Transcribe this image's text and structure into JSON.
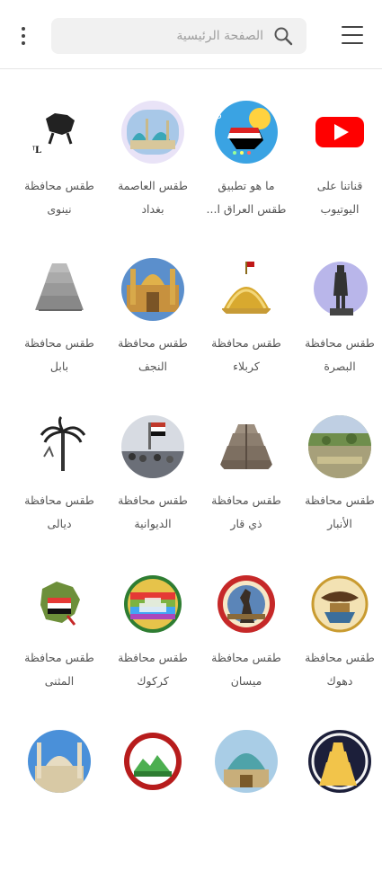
{
  "search": {
    "placeholder": "الصفحة الرئيسية"
  },
  "items": [
    {
      "label": "قناتنا على اليوتيوب"
    },
    {
      "label": "ما هو تطبيق طقس العراق ا..."
    },
    {
      "label": "طقس العاصمة بغداد"
    },
    {
      "label": "طقس محافظة نينوى"
    },
    {
      "label": "طقس محافظة البصرة"
    },
    {
      "label": "طقس محافظة كربلاء"
    },
    {
      "label": "طقس محافظة النجف"
    },
    {
      "label": "طقس محافظة بابل"
    },
    {
      "label": "طقس محافظة الأنبار"
    },
    {
      "label": "طقس محافظة ذي قار"
    },
    {
      "label": "طقس محافظة الديوانية"
    },
    {
      "label": "طقس محافظة ديالى"
    },
    {
      "label": "طقس محافظة دهوك"
    },
    {
      "label": "طقس محافظة ميسان"
    },
    {
      "label": "طقس محافظة كركوك"
    },
    {
      "label": "طقس محافظة المثنى"
    },
    {
      "label": ""
    },
    {
      "label": ""
    },
    {
      "label": ""
    },
    {
      "label": ""
    }
  ],
  "icons": {
    "ig-1": "youtube-icon",
    "ig-2": "iraq-weather-app-icon",
    "ig-3": "baghdad-mosque-icon",
    "ig-4": "mosul-logo-icon",
    "ig-5": "statue-icon",
    "ig-6": "golden-dome-icon",
    "ig-7": "najaf-shrine-icon",
    "ig-8": "babel-tower-icon",
    "ig-9": "anbar-landscape-icon",
    "ig-10": "ziggurat-icon",
    "ig-11": "crowd-flag-icon",
    "ig-12": "palm-tree-icon",
    "ig-13": "duhok-eagle-icon",
    "ig-14": "maysan-emblem-icon",
    "ig-15": "kirkuk-emblem-icon",
    "ig-16": "muthanna-map-icon",
    "ig-17": "mosque-icon",
    "ig-18": "emblem-icon",
    "ig-19": "blue-dome-icon",
    "ig-20": "spiral-minaret-icon"
  },
  "colors": {
    "youtube_red": "#ff0000",
    "label_gray": "#555555"
  }
}
